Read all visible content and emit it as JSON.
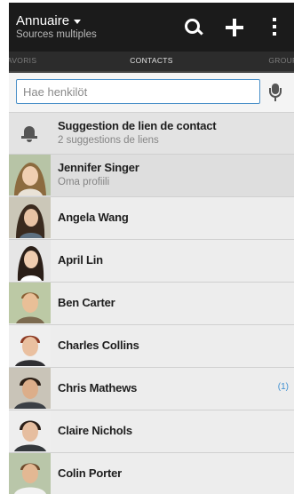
{
  "header": {
    "title": "Annuaire",
    "subtitle": "Sources multiples",
    "icons": [
      "search-icon",
      "add-icon",
      "overflow-menu-icon"
    ]
  },
  "tabs": {
    "left": "avoris",
    "center": "contacts",
    "right": "groupe"
  },
  "search": {
    "placeholder": "Hae henkilöt",
    "value": ""
  },
  "suggestion": {
    "title": "Suggestion de lien de contact",
    "subtitle": "2 suggestions de liens"
  },
  "my_profile": {
    "name": "Jennifer Singer",
    "subtitle": "Oma profiili"
  },
  "contacts": [
    {
      "name": "Angela Wang",
      "count": ""
    },
    {
      "name": "April Lin",
      "count": ""
    },
    {
      "name": "Ben Carter",
      "count": ""
    },
    {
      "name": "Charles Collins",
      "count": ""
    },
    {
      "name": "Chris Mathews",
      "count": "(1)"
    },
    {
      "name": "Claire Nichols",
      "count": ""
    },
    {
      "name": "Colin Porter",
      "count": ""
    }
  ],
  "colors": {
    "action_bar": "#1b1b1b",
    "tab_bar": "#2c2c2c",
    "accent": "#3d8fd1",
    "list_bg": "#ededed"
  }
}
